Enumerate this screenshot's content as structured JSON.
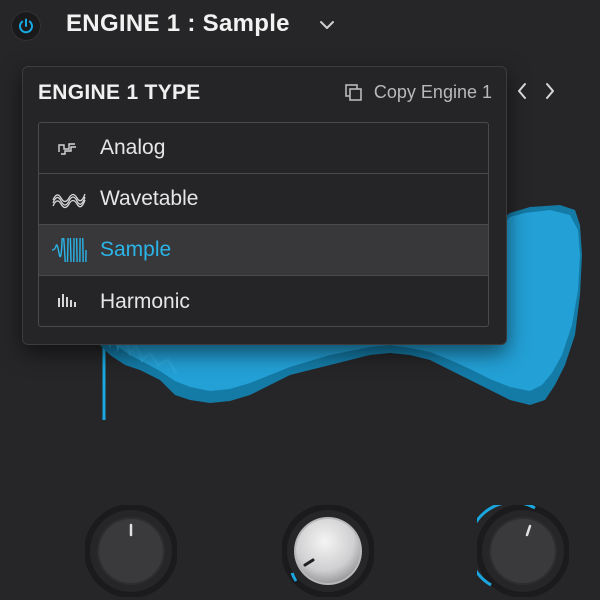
{
  "header": {
    "engine_title": "ENGINE 1 :  Sample",
    "power_on": true,
    "accent": "#17a9e1"
  },
  "popup": {
    "title": "ENGINE 1 TYPE",
    "copy_label": "Copy Engine 1",
    "types": [
      {
        "label": "Analog",
        "icon": "analog-icon",
        "selected": false
      },
      {
        "label": "Wavetable",
        "icon": "wavetable-icon",
        "selected": false
      },
      {
        "label": "Sample",
        "icon": "sample-icon",
        "selected": true
      },
      {
        "label": "Harmonic",
        "icon": "harmonic-icon",
        "selected": false
      }
    ]
  },
  "navigation": {
    "prev": "previous-arrow-icon",
    "next": "next-arrow-icon"
  },
  "knobs": [
    {
      "name": "knob-left",
      "value_fraction": 0.5,
      "style": "dark"
    },
    {
      "name": "knob-center",
      "value_fraction": 0.05,
      "style": "light"
    },
    {
      "name": "knob-right",
      "value_fraction": 0.55,
      "style": "dark"
    }
  ],
  "colors": {
    "background": "#262628",
    "waveform": "#1a8fc0",
    "waveform_light": "#2aa2d4",
    "selected_text": "#2ab4e8"
  }
}
